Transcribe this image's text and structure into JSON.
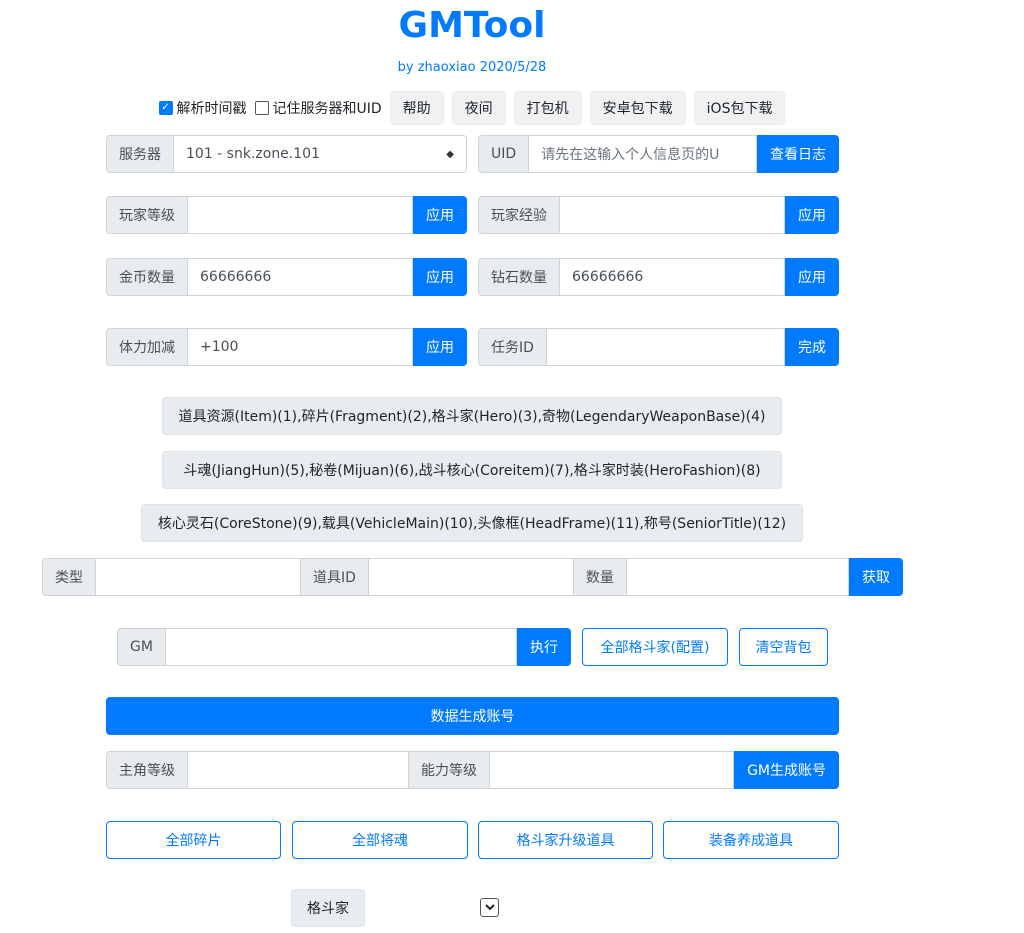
{
  "header": {
    "title": "GMTool",
    "subtitle": "by zhaoxiao 2020/5/28"
  },
  "toolbar": {
    "parse_timestamp": {
      "label": "解析时间戳",
      "checked": true
    },
    "remember_server": {
      "label": "记住服务器和UID",
      "checked": false
    },
    "help": "帮助",
    "night": "夜间",
    "pack": "打包机",
    "android_download": "安卓包下载",
    "ios_download": "iOS包下载"
  },
  "server": {
    "label": "服务器",
    "selected": "101 - snk.zone.101"
  },
  "uid": {
    "label": "UID",
    "placeholder": "请先在这输入个人信息页的U",
    "button": "查看日志"
  },
  "player_level": {
    "label": "玩家等级",
    "value": "",
    "button": "应用"
  },
  "player_exp": {
    "label": "玩家经验",
    "value": "",
    "button": "应用"
  },
  "gold": {
    "label": "金币数量",
    "value": "66666666",
    "button": "应用"
  },
  "diamond": {
    "label": "钻石数量",
    "value": "66666666",
    "button": "应用"
  },
  "stamina": {
    "label": "体力加减",
    "value": "+100",
    "button": "应用"
  },
  "task": {
    "label": "任务ID",
    "value": "",
    "button": "完成"
  },
  "type_buttons": [
    "道具资源(Item)(1),碎片(Fragment)(2),格斗家(Hero)(3),奇物(LegendaryWeaponBase)(4)",
    "斗魂(JiangHun)(5),秘卷(Mijuan)(6),战斗核心(Coreitem)(7),格斗家时装(HeroFashion)(8)",
    "核心灵石(CoreStone)(9),载具(VehicleMain)(10),头像框(HeadFrame)(11),称号(SeniorTitle)(12)"
  ],
  "item_row": {
    "type_label": "类型",
    "item_id_label": "道具ID",
    "quantity_label": "数量",
    "button": "获取"
  },
  "gm": {
    "label": "GM",
    "execute": "执行",
    "all_heroes": "全部格斗家(配置)",
    "clear_bag": "清空背包"
  },
  "data_generate": "数据生成账号",
  "account": {
    "main_level_label": "主角等级",
    "ability_level_label": "能力等级",
    "button": "GM生成账号"
  },
  "bulk_buttons": {
    "all_fragments": "全部碎片",
    "all_souls": "全部将魂",
    "hero_upgrade": "格斗家升级道具",
    "equip_items": "装备养成道具"
  },
  "fighter": {
    "label": "格斗家",
    "dropdown_icon": "chevron-down-icon"
  }
}
